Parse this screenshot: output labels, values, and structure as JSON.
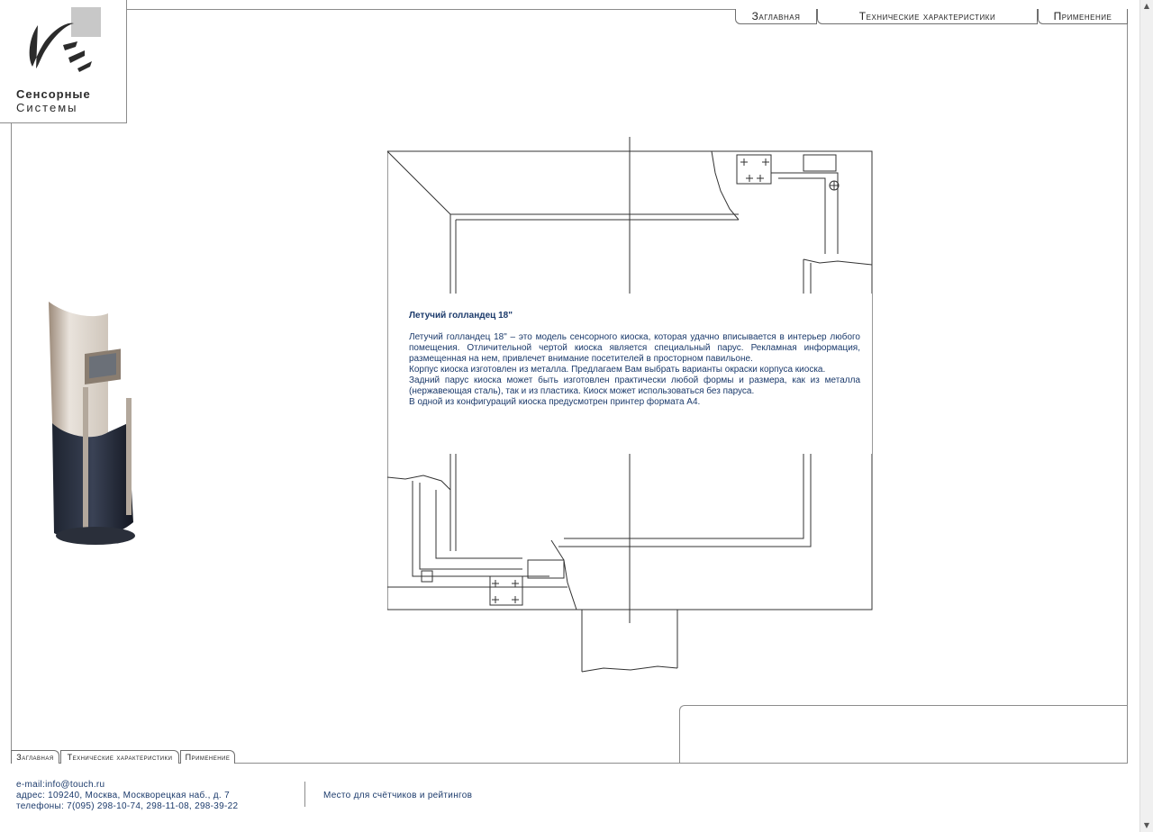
{
  "logo": {
    "line1": "Сенсорные",
    "line2": "Системы"
  },
  "nav_top": [
    {
      "label": "Заглавная"
    },
    {
      "label": "Технические характеристики"
    },
    {
      "label": "Применение"
    }
  ],
  "nav_bottom": [
    {
      "label": "Заглавная"
    },
    {
      "label": "Технические характеристики"
    },
    {
      "label": "Применение"
    }
  ],
  "description": {
    "title": "Летучий голландец 18\"",
    "paragraphs": [
      "Летучий голландец 18\" – это модель сенсорного киоска, которая удачно вписывается в интерьер любого помещения. Отличительной чертой киоска является специальный парус. Рекламная информация, размещенная на нем, привлечет внимание посетителей в просторном павильоне.",
      "Корпус киоска изготовлен из металла. Предлагаем Вам выбрать варианты окраски корпуса киоска.",
      "Задний парус киоска может быть изготовлен практически любой формы и размера, как из металла (нержавеющая сталь), так и из пластика. Киоск может использоваться без паруса.",
      "В одной из конфигураций киоска предусмотрен принтер формата А4."
    ]
  },
  "footer": {
    "email": "e-mail:info@touch.ru",
    "address": "адрес: 109240, Москва, Москворецкая наб., д. 7",
    "phones": "телефоны: 7(095) 298-10-74, 298-11-08, 298-39-22",
    "counters": "Место для счётчиков и рейтингов"
  },
  "colors": {
    "text": "#1b3a6b",
    "frame": "#8c8c8c",
    "logo_accent": "#c8c8c8"
  }
}
